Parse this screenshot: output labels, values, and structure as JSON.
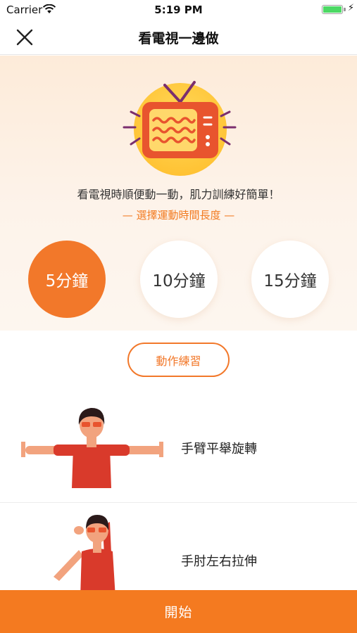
{
  "status_bar": {
    "carrier": "Carrier",
    "time": "5:19 PM",
    "icons": [
      "wifi-icon",
      "battery-icon",
      "charging-bolt-icon"
    ]
  },
  "nav": {
    "title": "看電視一邊做",
    "close_icon": "close-icon"
  },
  "hero": {
    "illustration": "tv-icon",
    "subtitle": "看電視時順便動一動，肌力訓練好簡單！",
    "select_prompt": "— 選擇運動時間長度 —"
  },
  "durations": [
    {
      "label": "5分鐘",
      "selected": true
    },
    {
      "label": "10分鐘",
      "selected": false
    },
    {
      "label": "15分鐘",
      "selected": false
    }
  ],
  "practice_button": "動作練習",
  "exercises": [
    {
      "label": "手臂平舉旋轉",
      "illustration": "arm-raise-rotation-figure"
    },
    {
      "label": "手肘左右拉伸",
      "illustration": "elbow-stretch-figure"
    }
  ],
  "start_button": "開始",
  "colors": {
    "accent": "#f47a20",
    "hero_background": "#fdebd9",
    "battery": "#4cd964",
    "tv_purple": "#7b2e6e"
  }
}
